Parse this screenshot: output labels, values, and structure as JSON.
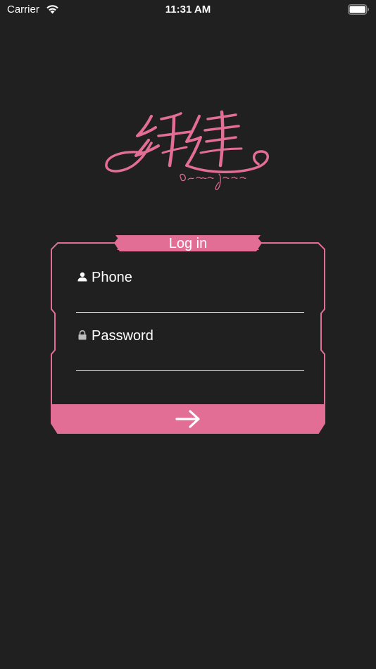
{
  "status_bar": {
    "carrier": "Carrier",
    "time": "11:31 AM"
  },
  "login": {
    "title": "Log in",
    "phone_label": "Phone",
    "phone_value": "",
    "password_label": "Password",
    "password_value": ""
  },
  "icons": {
    "wifi": "wifi-icon",
    "battery": "battery-icon",
    "user": "user-icon",
    "lock": "lock-icon",
    "arrow": "arrow-right-icon"
  },
  "colors": {
    "background": "#202020",
    "accent": "#e26e96",
    "text": "#ffffff"
  }
}
